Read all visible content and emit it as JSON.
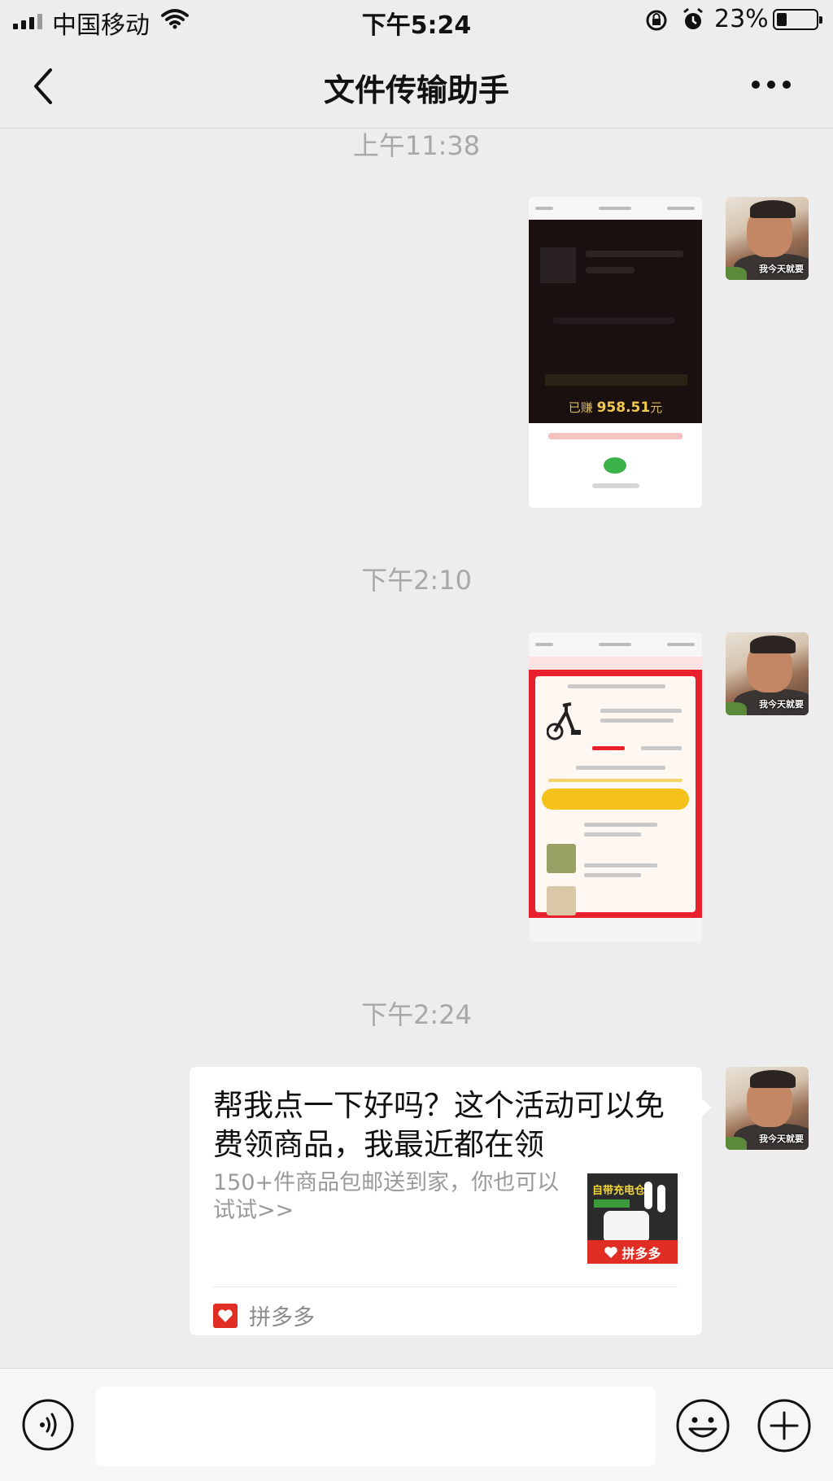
{
  "status_bar": {
    "carrier": "中国移动",
    "time": "下午5:24",
    "battery": "23%"
  },
  "nav": {
    "title": "文件传输助手"
  },
  "messages": {
    "ts1": "上午11:38",
    "ts2": "下午2:10",
    "ts3": "下午2:24",
    "avatar_caption": "我今天就要",
    "shot1_amount_prefix": "已赚",
    "shot1_amount": "958.51",
    "shot1_amount_unit": "元",
    "link_card": {
      "title": "帮我点一下好吗？这个活动可以免费领商品，我最近都在领",
      "description": "150+件商品包邮送到家，你也可以试试>>",
      "thumb_headline": "自带充电仓",
      "thumb_brand": "拼多多",
      "source": "拼多多"
    }
  },
  "colors": {
    "background": "#ededed",
    "brand_red": "#e02e24"
  },
  "icons": {
    "back": "chevron-left-icon",
    "more": "ellipsis-icon",
    "voice": "voice-icon",
    "emoji": "emoji-icon",
    "plus": "plus-circle-icon"
  }
}
